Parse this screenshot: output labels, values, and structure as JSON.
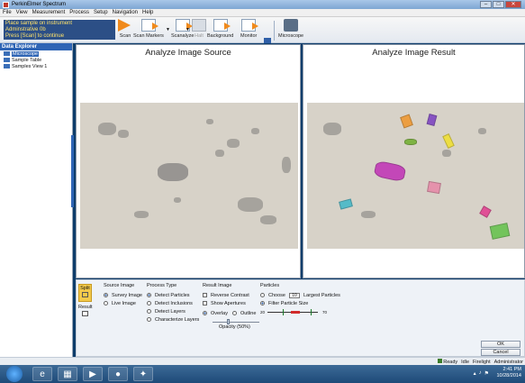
{
  "window": {
    "title": "PerkinElmer Spectrum"
  },
  "menu": [
    "File",
    "View",
    "Measurement",
    "Process",
    "Setup",
    "Navigation",
    "Help"
  ],
  "ribbon": {
    "instruction": [
      "Place sample on instrument",
      "Adminstrative 0b",
      "Press [Scan] to continue"
    ],
    "scan": "Scan",
    "scan_markers": "Scan Markers",
    "scanalyze": "Scanalyze",
    "halt": "Halt",
    "background": "Background",
    "monitor": "Monitor",
    "microscope": "Microscope"
  },
  "sidebar": {
    "header": "Data Explorer",
    "items": [
      "Microscope",
      "Sample Table",
      "Samples View 1"
    ]
  },
  "panels": {
    "source_title": "Analyze Image Source",
    "result_title": "Analyze Image Result"
  },
  "bottom": {
    "split_label": "Split",
    "result_label": "Result",
    "source_image": {
      "title": "Source Image",
      "options": [
        "Survey Image",
        "Live Image"
      ],
      "selected": "Survey Image"
    },
    "process_type": {
      "title": "Process Type",
      "options": [
        "Detect Particles",
        "Detect Inclusions",
        "Detect Layers",
        "Characterize Layers"
      ],
      "selected": "Detect Particles"
    },
    "result_image": {
      "title": "Result Image",
      "reverse_contrast": "Reverse Contrast",
      "show_apertures": "Show Apertures",
      "overlay": "Overlay",
      "outline": "Outline",
      "opacity_label": "Opacity (50%)",
      "opacity": 0.5
    },
    "particles": {
      "title": "Particles",
      "choose_label": "Choose",
      "choose_value": "10",
      "largest_label": "Largest Particles",
      "filter_label": "Filter Particle Size",
      "range_min": "20",
      "range_max": "70"
    },
    "ok": "OK",
    "cancel": "Cancel"
  },
  "status": {
    "ready": "Ready",
    "idle": "Idle",
    "firelight": "Firelight",
    "admin": "Administrator"
  },
  "taskbar": {
    "time": "2:41 PM",
    "date": "10/28/2014"
  },
  "colors": {
    "accent": "#2f65b5",
    "instruction_bg": "#2c4f86",
    "instruction_text": "#ffe36a"
  }
}
